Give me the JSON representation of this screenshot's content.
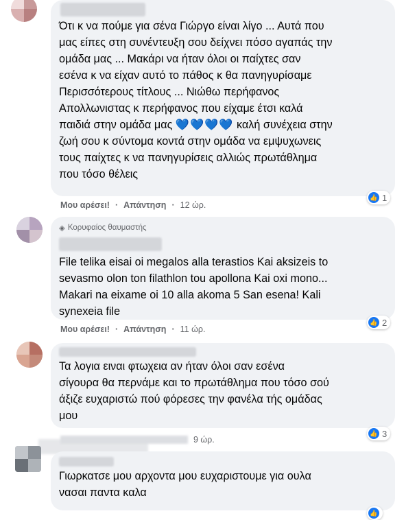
{
  "comments": [
    {
      "text": "Ότι κ να πούμε για σένα Γιώργο είναι λίγο ... Αυτά που\nμας είπες στη συνέντευξη σου δείχνει πόσο αγαπάς την\nομάδα μας ... Μακάρι να ήταν όλοι οι παίχτες σαν\nεσένα κ να είχαν αυτό το πάθος κ θα πανηγυρίσαμε\nΠερισσότερους τίτλους ... Νιώθω περήφανος\nΑπολλωνιστας κ περήφανος που είχαμε έτσι καλά\nπαιδιά στην ομάδα μας",
      "hearts": "💙💙💙💙",
      "text_after": " καλή συνέχεια στην\nζωή σου κ σύντομα κοντά στην ομάδα να εμψυχωνεις\nτους παίχτες κ να πανηγυρίσεις αλλιώς πρωτάθλημα\nπου τόσο θέλεις",
      "like_label": "Μου αρέσει!",
      "reply_label": "Απάντηση",
      "time": "12 ώρ.",
      "reaction_count": "1"
    },
    {
      "badge": "Κορυφαίος θαυμαστής",
      "text": "File telika eisai oi megalos alla terastios Kai aksizeis to\nsevasmo olon ton filathlon tou apollona Kai oxi mono...\nMakari na eixame oi 10 alla akoma 5 San esena! Kali\nsynexeia file",
      "like_label": "Μου αρέσει!",
      "reply_label": "Απάντηση",
      "time": "11 ώρ.",
      "reaction_count": "2"
    },
    {
      "text": "Τα λογια ειναι φτωχεια αν ήταν όλοι σαν εσένα\nσίγουρα θα περνάμε και το πρωτάθλημα που τόσο σού\nάξιζε ευχαριστώ πού φόρεσες την φανέλα τής ομάδας\nμου",
      "time": "9 ώρ.",
      "reaction_count": "3"
    },
    {
      "text": "Γιωρκατσε μου αρχοντα μου ευχαριστουμε για ουλα\nνασαι παντα καλα"
    }
  ],
  "icons": {
    "like": "thumbs-up-icon",
    "badge": "diamond-icon"
  },
  "colors": {
    "bubble": "#f0f2f5",
    "like_blue": "#1877f2",
    "meta_gray": "#65676b"
  }
}
